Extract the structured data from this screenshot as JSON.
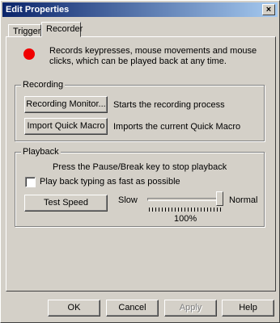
{
  "window": {
    "title": "Edit Properties",
    "close_glyph": "×"
  },
  "tabs": [
    "Trigger",
    "Recorder"
  ],
  "recorder": {
    "description": "Records keypresses, mouse movements and mouse clicks, which can be played back at any time.",
    "recording": {
      "group_label": "Recording",
      "monitor_button": "Recording Monitor...",
      "monitor_desc": "Starts the recording process",
      "import_button": "Import Quick Macro",
      "import_desc": "Imports the current Quick Macro"
    },
    "playback": {
      "group_label": "Playback",
      "hint": "Press the Pause/Break key to stop playback",
      "fast_typing_label": "Play back typing as fast as possible",
      "fast_typing_checked": false,
      "test_speed_button": "Test Speed",
      "speed_slow_label": "Slow",
      "speed_normal_label": "Normal",
      "speed_value": "100%",
      "speed_fraction": 1.0
    }
  },
  "footer": {
    "ok": "OK",
    "cancel": "Cancel",
    "apply": "Apply",
    "help": "Help"
  },
  "colors": {
    "record_dot": "#f00000",
    "titlebar_start": "#0a246a",
    "titlebar_end": "#a6caf0"
  },
  "icons": {
    "close": "close-icon",
    "record": "record-dot-icon"
  }
}
